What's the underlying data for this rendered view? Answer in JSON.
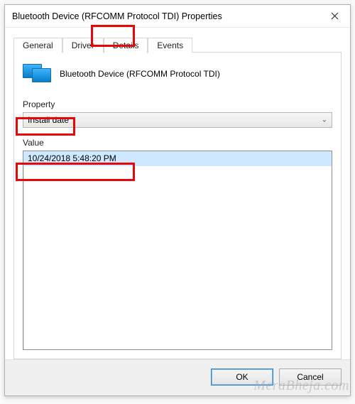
{
  "window": {
    "title": "Bluetooth Device (RFCOMM Protocol TDI) Properties"
  },
  "tabs": {
    "general": "General",
    "driver": "Driver",
    "details": "Details",
    "events": "Events",
    "active": "details"
  },
  "device": {
    "name": "Bluetooth Device (RFCOMM Protocol TDI)"
  },
  "property": {
    "label": "Property",
    "selected": "Install date"
  },
  "value": {
    "label": "Value",
    "items": [
      "10/24/2018 5:48:20 PM"
    ]
  },
  "buttons": {
    "ok": "OK",
    "cancel": "Cancel"
  },
  "watermark": "MeraBheja.com"
}
